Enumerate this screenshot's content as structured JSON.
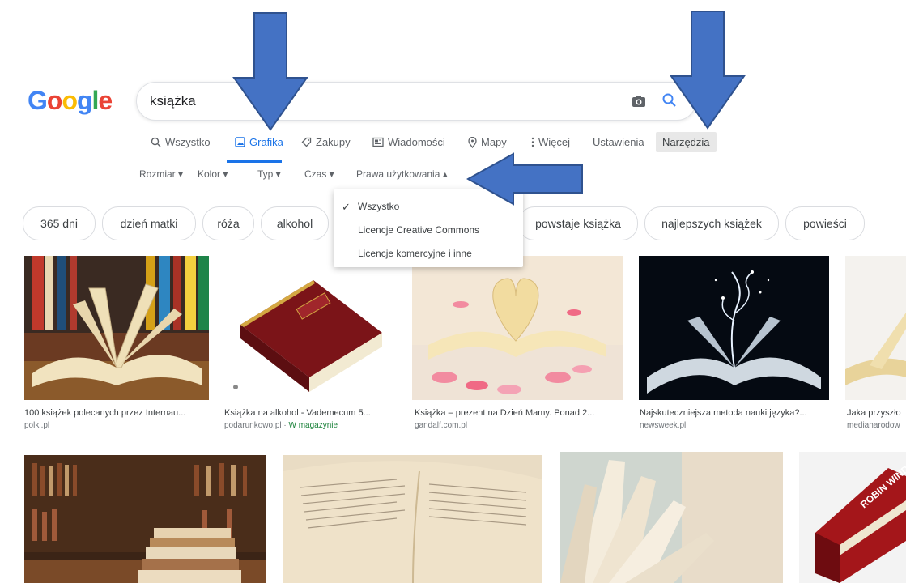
{
  "logo": {
    "text": [
      "G",
      "o",
      "o",
      "g",
      "l",
      "e"
    ],
    "colors": [
      "#4285F4",
      "#EA4335",
      "#FBBC05",
      "#4285F4",
      "#34A853",
      "#EA4335"
    ]
  },
  "search": {
    "query": "książka",
    "camera_icon": "camera-icon",
    "search_icon": "magnifier-icon"
  },
  "tabs": [
    {
      "label": "Wszystko",
      "icon": "search-icon",
      "active": false
    },
    {
      "label": "Grafika",
      "icon": "image-icon",
      "active": true
    },
    {
      "label": "Zakupy",
      "icon": "tag-icon",
      "active": false
    },
    {
      "label": "Wiadomości",
      "icon": "newspaper-icon",
      "active": false
    },
    {
      "label": "Mapy",
      "icon": "map-pin-icon",
      "active": false
    },
    {
      "label": "Więcej",
      "icon": "kebab-icon",
      "active": false
    }
  ],
  "settings_label": "Ustawienia",
  "tools_label": "Narzędzia",
  "filters": [
    "Rozmiar ▾",
    "Kolor ▾",
    "Typ ▾",
    "Czas ▾",
    "Prawa użytkowania ▴"
  ],
  "chips": [
    "365 dni",
    "dzień matki",
    "róża",
    "alkohol",
    "powstaje książka",
    "najlepszych książek",
    "powieści"
  ],
  "dropdown": {
    "items": [
      "Wszystko",
      "Licencje Creative Commons",
      "Licencje komercyjne i inne"
    ],
    "selected": "Wszystko"
  },
  "results_row1": [
    {
      "title": "100 książek polecanych przez Internau...",
      "source": "polki.pl",
      "extra": ""
    },
    {
      "title": "Książka na alkohol - Vademecum 5...",
      "source": "podarunkowo.pl · ",
      "extra": "W magazynie"
    },
    {
      "title": "Książka – prezent na Dzień Mamy. Ponad 2...",
      "source": "gandalf.com.pl",
      "extra": ""
    },
    {
      "title": "Najskuteczniejsza metoda nauki języka?...",
      "source": "newsweek.pl",
      "extra": ""
    },
    {
      "title": "Jaka przyszło",
      "source": "medianarodow",
      "extra": ""
    }
  ],
  "book_cover_text": "ROBIN WIND",
  "colors": {
    "accent": "#1a73e8",
    "arrow_fill": "#4472c4",
    "arrow_stroke": "#2f528f"
  }
}
